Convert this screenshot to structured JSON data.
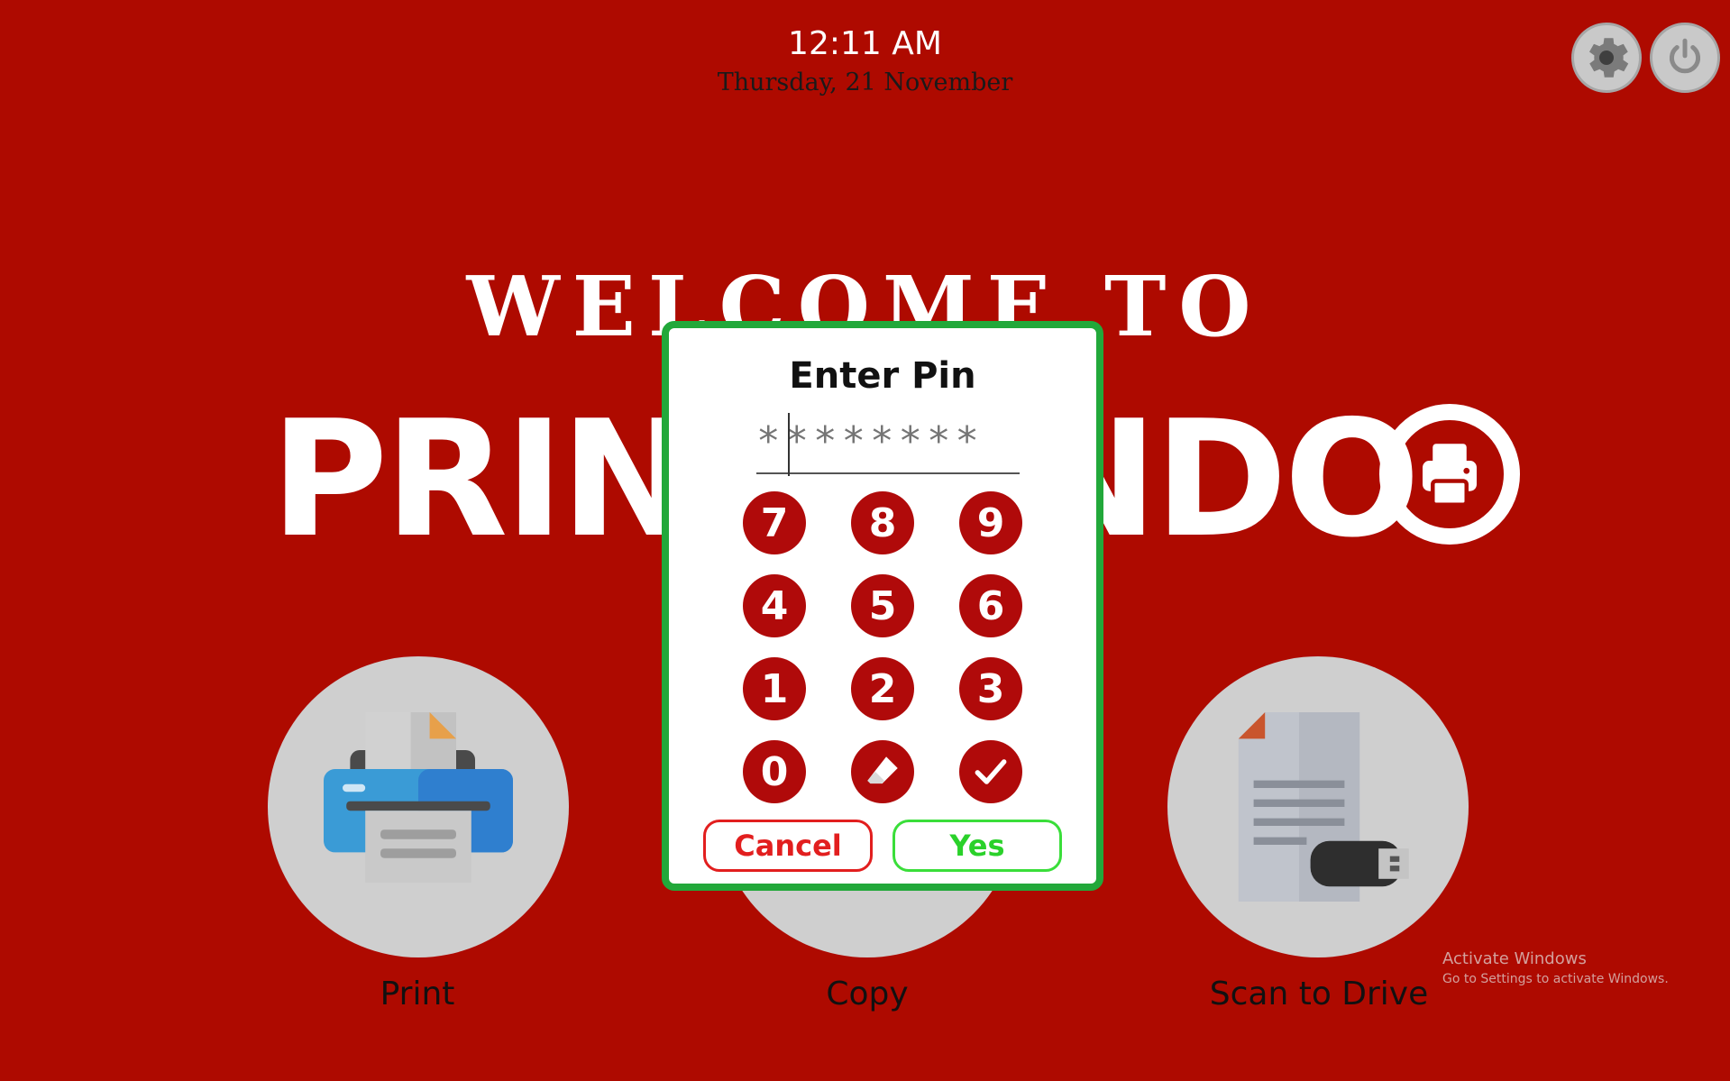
{
  "clock": {
    "time": "12:11 AM",
    "date": "Thursday, 21 November"
  },
  "header": {
    "settings_icon": "gear-icon",
    "power_icon": "power-icon"
  },
  "welcome": {
    "line1": "WELCOME TO",
    "brand": "PRINTVENDO",
    "brand_logo_icon": "printer-icon"
  },
  "services": [
    {
      "label": "Print",
      "icon": "printer-icon"
    },
    {
      "label": "Copy",
      "icon": "copier-icon"
    },
    {
      "label": "Scan to Drive",
      "icon": "usb-drive-icon"
    }
  ],
  "pin_dialog": {
    "title": "Enter Pin",
    "placeholder": "********",
    "value": "",
    "keys": [
      "7",
      "8",
      "9",
      "4",
      "5",
      "6",
      "1",
      "2",
      "3",
      "0"
    ],
    "erase_icon": "eraser-icon",
    "confirm_icon": "check-icon",
    "cancel_label": "Cancel",
    "yes_label": "Yes"
  },
  "watermark": {
    "title": "Activate Windows",
    "subtitle": "Go to Settings to activate Windows."
  },
  "colors": {
    "background": "#ae0a00",
    "key": "#b00a0a",
    "dialog_border": "#22a83a",
    "cancel": "#e21e1e",
    "yes": "#2ad12a"
  }
}
